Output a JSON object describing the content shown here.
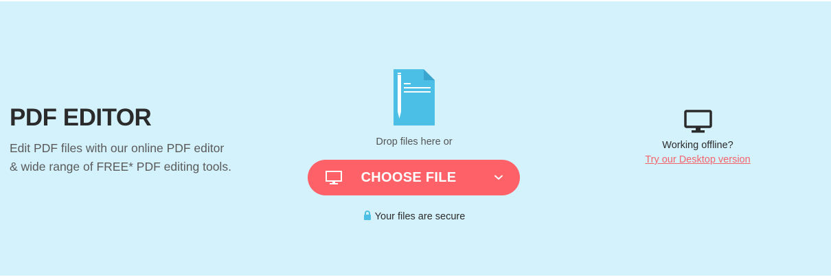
{
  "hero": {
    "title": "PDF EDITOR",
    "description_line1": "Edit PDF files with our online PDF editor",
    "description_line2": "& wide range of FREE* PDF editing tools."
  },
  "upload": {
    "icon": "pdf-document-pencil-icon",
    "drop_text": "Drop files here or",
    "choose_label": "CHOOSE FILE",
    "button_icon": "monitor-icon",
    "dropdown_icon": "chevron-down-icon",
    "secure_text": "Your files are secure",
    "secure_icon": "lock-icon"
  },
  "desktop": {
    "icon": "desktop-monitor-icon",
    "offline_text": "Working offline?",
    "link_text": "Try our Desktop version"
  },
  "colors": {
    "background": "#d4f2fc",
    "accent": "#fe6167",
    "link": "#f4636a",
    "icon_blue": "#4bbfe6",
    "heading": "#2b2b2b"
  }
}
